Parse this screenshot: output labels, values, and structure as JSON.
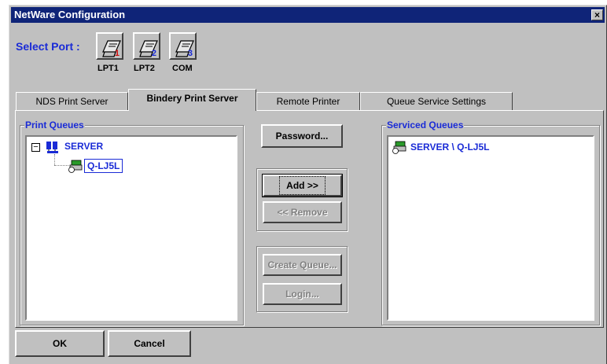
{
  "window": {
    "title": "NetWare Configuration",
    "close_symbol": "×"
  },
  "select_port": {
    "label": "Select Port :",
    "ports": [
      {
        "label": "LPT1",
        "number": "1",
        "number_color": "#d01010"
      },
      {
        "label": "LPT2",
        "number": "2",
        "number_color": "#1a2bd6"
      },
      {
        "label": "COM",
        "number": "3",
        "number_color": "#1a2bd6"
      }
    ]
  },
  "tabs": [
    {
      "label": "NDS Print Server",
      "active": false
    },
    {
      "label": "Bindery Print Server",
      "active": true
    },
    {
      "label": "Remote Printer",
      "active": false
    },
    {
      "label": "Queue Service Settings",
      "active": false
    }
  ],
  "print_queues": {
    "title": "Print Queues",
    "tree": {
      "expander": "−",
      "root": "SERVER",
      "child": "Q-LJ5L"
    }
  },
  "serviced_queues": {
    "title": "Serviced Queues",
    "items": [
      "SERVER \\ Q-LJ5L"
    ]
  },
  "buttons": {
    "password": "Password...",
    "add": "Add >>",
    "remove": "<< Remove",
    "create_queue": "Create Queue...",
    "login": "Login...",
    "ok": "OK",
    "cancel": "Cancel"
  },
  "colors": {
    "title_bar": "#0f2478",
    "accent_text": "#1a2bd6",
    "dialog_bg": "#c0c0c0"
  }
}
